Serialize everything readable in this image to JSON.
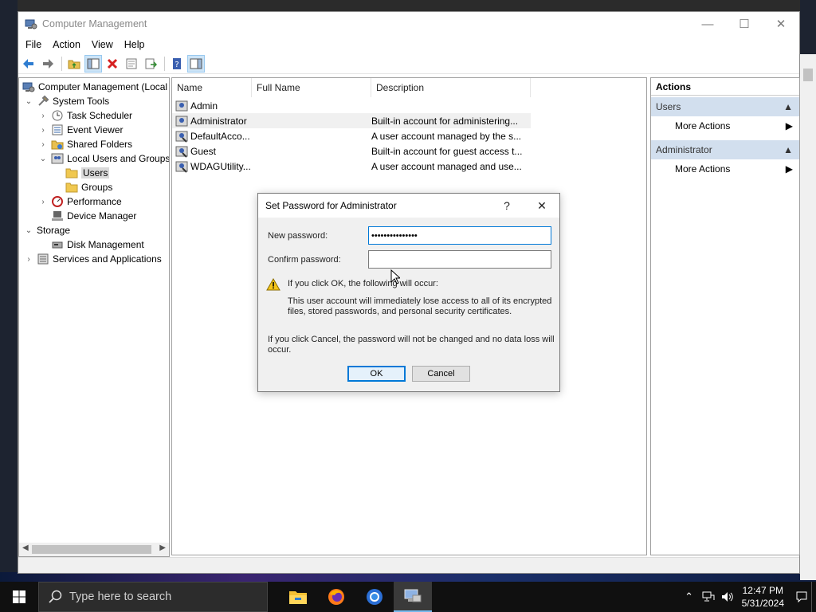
{
  "window": {
    "title": "Computer Management",
    "controls": {
      "minimize": "—",
      "maximize": "☐",
      "close": "✕"
    }
  },
  "menu": [
    "File",
    "Action",
    "View",
    "Help"
  ],
  "tree": [
    {
      "label": "Computer Management (Local",
      "level": 0,
      "arrow": "",
      "icon": "computer-icon",
      "selected": false
    },
    {
      "label": "System Tools",
      "level": 1,
      "arrow": "⌄",
      "icon": "tools-icon",
      "selected": false
    },
    {
      "label": "Task Scheduler",
      "level": 2,
      "arrow": "›",
      "icon": "clock-icon",
      "selected": false
    },
    {
      "label": "Event Viewer",
      "level": 2,
      "arrow": "›",
      "icon": "event-icon",
      "selected": false
    },
    {
      "label": "Shared Folders",
      "level": 2,
      "arrow": "›",
      "icon": "shared-folder-icon",
      "selected": false
    },
    {
      "label": "Local Users and Groups",
      "level": 2,
      "arrow": "⌄",
      "icon": "users-groups-icon",
      "selected": false
    },
    {
      "label": "Users",
      "level": 3,
      "arrow": "",
      "icon": "folder-icon",
      "selected": true
    },
    {
      "label": "Groups",
      "level": 3,
      "arrow": "",
      "icon": "folder-icon",
      "selected": false
    },
    {
      "label": "Performance",
      "level": 2,
      "arrow": "›",
      "icon": "performance-icon",
      "selected": false
    },
    {
      "label": "Device Manager",
      "level": 2,
      "arrow": "",
      "icon": "device-manager-icon",
      "selected": false
    },
    {
      "label": "Storage",
      "level": 1,
      "arrow": "⌄",
      "icon": "storage-icon",
      "selected": false
    },
    {
      "label": "Disk Management",
      "level": 2,
      "arrow": "",
      "icon": "disk-icon",
      "selected": false
    },
    {
      "label": "Services and Applications",
      "level": 1,
      "arrow": "›",
      "icon": "services-icon",
      "selected": false
    }
  ],
  "list": {
    "columns": [
      "Name",
      "Full Name",
      "Description"
    ],
    "rows": [
      {
        "name": "Admin",
        "full_name": "",
        "description": "",
        "highlight": false
      },
      {
        "name": "Administrator",
        "full_name": "",
        "description": "Built-in account for administering...",
        "highlight": true
      },
      {
        "name": "DefaultAcco...",
        "full_name": "",
        "description": "A user account managed by the s...",
        "highlight": false
      },
      {
        "name": "Guest",
        "full_name": "",
        "description": "Built-in account for guest access t...",
        "highlight": false
      },
      {
        "name": "WDAGUtility...",
        "full_name": "",
        "description": "A user account managed and use...",
        "highlight": false
      }
    ]
  },
  "actions": {
    "title": "Actions",
    "sections": [
      {
        "label": "Users",
        "item": "More Actions"
      },
      {
        "label": "Administrator",
        "item": "More Actions"
      }
    ]
  },
  "dialog": {
    "title": "Set Password for Administrator",
    "help": "?",
    "close": "✕",
    "new_password_label": "New password:",
    "new_password_value": "•••••••••••••••",
    "confirm_password_label": "Confirm password:",
    "confirm_password_value": "",
    "warning_heading": "If you click OK, the following will occur:",
    "warning_body_1": "This user account will immediately lose access to all of its encrypted",
    "warning_body_2": "files, stored passwords, and personal security certificates.",
    "cancel_note_1": "If you click Cancel, the password will not be changed and no data loss will",
    "cancel_note_2": "occur.",
    "ok_label": "OK",
    "cancel_label": "Cancel"
  },
  "taskbar": {
    "search_placeholder": "Type here to search",
    "time": "12:47 PM",
    "date": "5/31/2024",
    "apps": [
      "file-explorer-icon",
      "firefox-icon",
      "chrome-icon",
      "computer-management-icon"
    ]
  },
  "colors": {
    "accent": "#0078d7",
    "actions_section_bg": "#d2dfee",
    "taskbar_bg": "#101010"
  }
}
